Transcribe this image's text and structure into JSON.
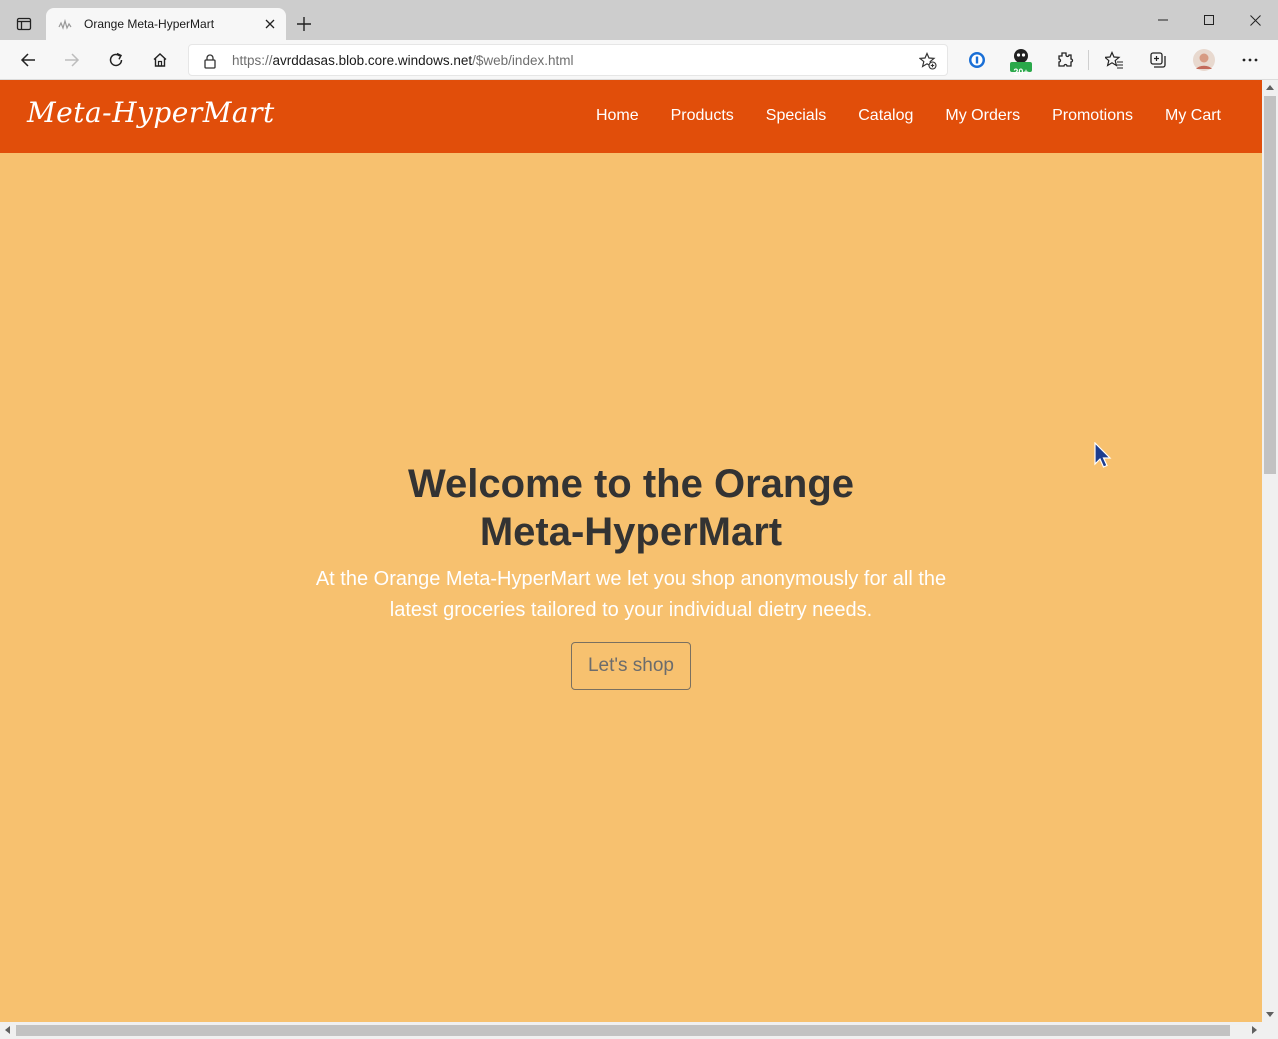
{
  "browser": {
    "tab": {
      "title": "Orange Meta-HyperMart"
    },
    "address": {
      "url_prefix": "https://",
      "url_host": "avrddasas.blob.core.windows.net",
      "url_path": "/$web/index.html"
    },
    "extension_badge": "20+"
  },
  "site": {
    "brand": "Meta-HyperMart",
    "nav": [
      {
        "label": "Home"
      },
      {
        "label": "Products"
      },
      {
        "label": "Specials"
      },
      {
        "label": "Catalog"
      },
      {
        "label": "My Orders"
      },
      {
        "label": "Promotions"
      },
      {
        "label": "My Cart"
      }
    ]
  },
  "hero": {
    "title": "Welcome to the Orange Meta-HyperMart",
    "text": "At the Orange Meta-HyperMart we let you shop anonymously for all the latest groceries tailored to your individual dietry needs.",
    "button_label": "Let's shop"
  },
  "colors": {
    "nav_bg": "#e14e0a",
    "page_bg": "#f7c16f",
    "title_text": "#333333",
    "body_text": "#ffffff"
  }
}
